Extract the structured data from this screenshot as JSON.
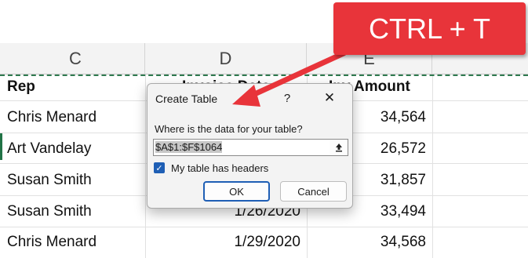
{
  "columns": [
    {
      "letter": "C"
    },
    {
      "letter": "D"
    },
    {
      "letter": "E"
    }
  ],
  "headers": {
    "rep": "Rep",
    "date": "Invoice Date",
    "amount": "Inv Amount"
  },
  "rows": [
    {
      "rep": "Chris Menard",
      "date": "",
      "amount": "34,564"
    },
    {
      "rep": "Art Vandelay",
      "date": "",
      "amount": "26,572"
    },
    {
      "rep": "Susan Smith",
      "date": "",
      "amount": "31,857"
    },
    {
      "rep": "Susan Smith",
      "date": "1/26/2020",
      "amount": "33,494"
    },
    {
      "rep": "Chris Menard",
      "date": "1/29/2020",
      "amount": "34,568"
    }
  ],
  "callout": {
    "text": "CTRL + T",
    "color": "#e8343a"
  },
  "dialog": {
    "title": "Create Table",
    "help": "?",
    "close": "✕",
    "question": "Where is the data for your table?",
    "range": "$A$1:$F$1064",
    "checkbox_label": "My table has headers",
    "checkbox_checked": true,
    "ok_label": "OK",
    "cancel_label": "Cancel"
  },
  "icons": {
    "collapse": "range-collapse-icon",
    "check": "checkmark-icon"
  },
  "colors": {
    "accent": "#1f5fb5",
    "selection": "#217346"
  }
}
